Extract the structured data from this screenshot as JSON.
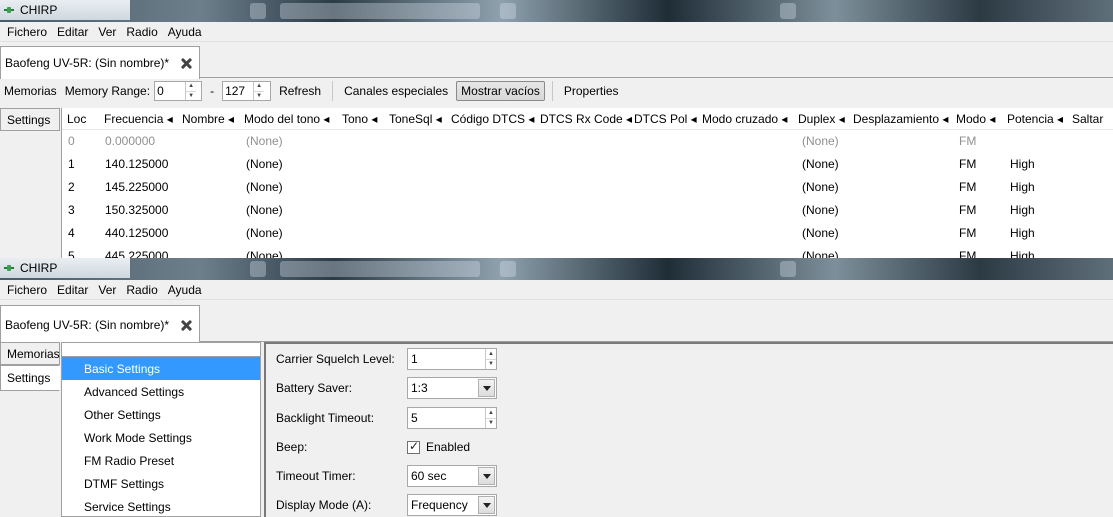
{
  "window1": {
    "title": "CHIRP",
    "menu": [
      "Fichero",
      "Editar",
      "Ver",
      "Radio",
      "Ayuda"
    ],
    "doc_tab": "Baofeng UV-5R: (Sin nombre)*",
    "toolbar": {
      "memorias_label": "Memorias",
      "range_label": "Memory Range:",
      "range_start": "0",
      "range_dash": "-",
      "range_end": "127",
      "refresh": "Refresh",
      "special_channels": "Canales especiales",
      "show_empty": "Mostrar vacíos",
      "properties": "Properties"
    },
    "side_tab_settings": "Settings",
    "columns": [
      "Loc",
      "Frecuencia",
      "Nombre",
      "Modo del tono",
      "Tono",
      "ToneSql",
      "Código DTCS",
      "DTCS Rx Code",
      "DTCS Pol",
      "Modo cruzado",
      "Duplex",
      "Desplazamiento",
      "Modo",
      "Potencia",
      "Saltar"
    ],
    "rows": [
      {
        "loc": "0",
        "freq": "0.000000",
        "tone_mode": "(None)",
        "duplex": "(None)",
        "mode": "FM",
        "power": ""
      },
      {
        "loc": "1",
        "freq": "140.125000",
        "tone_mode": "(None)",
        "duplex": "(None)",
        "mode": "FM",
        "power": "High"
      },
      {
        "loc": "2",
        "freq": "145.225000",
        "tone_mode": "(None)",
        "duplex": "(None)",
        "mode": "FM",
        "power": "High"
      },
      {
        "loc": "3",
        "freq": "150.325000",
        "tone_mode": "(None)",
        "duplex": "(None)",
        "mode": "FM",
        "power": "High"
      },
      {
        "loc": "4",
        "freq": "440.125000",
        "tone_mode": "(None)",
        "duplex": "(None)",
        "mode": "FM",
        "power": "High"
      },
      {
        "loc": "5",
        "freq": "445.225000",
        "tone_mode": "(None)",
        "duplex": "(None)",
        "mode": "FM",
        "power": "High"
      }
    ]
  },
  "window2": {
    "title": "CHIRP",
    "menu": [
      "Fichero",
      "Editar",
      "Ver",
      "Radio",
      "Ayuda"
    ],
    "doc_tab": "Baofeng UV-5R: (Sin nombre)*",
    "side_tabs": [
      "Memorias",
      "Settings"
    ],
    "tree_items": [
      "Basic Settings",
      "Advanced Settings",
      "Other Settings",
      "Work Mode Settings",
      "FM Radio Preset",
      "DTMF Settings",
      "Service Settings"
    ],
    "form": {
      "carrier_squelch": {
        "label": "Carrier Squelch Level:",
        "value": "1"
      },
      "battery_saver": {
        "label": "Battery Saver:",
        "value": "1:3"
      },
      "backlight_timeout": {
        "label": "Backlight Timeout:",
        "value": "5"
      },
      "beep": {
        "label": "Beep:",
        "check_label": "Enabled",
        "checked": true
      },
      "timeout_timer": {
        "label": "Timeout Timer:",
        "value": "60 sec"
      },
      "display_mode_a": {
        "label": "Display Mode (A):",
        "value": "Frequency"
      }
    }
  }
}
